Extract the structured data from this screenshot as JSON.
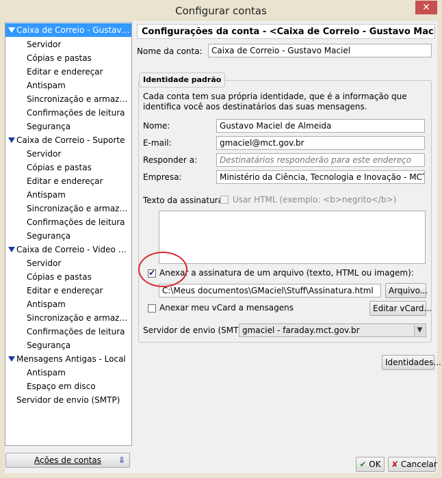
{
  "window": {
    "title": "Configurar contas",
    "close_glyph": "✕"
  },
  "tree": {
    "accounts": [
      {
        "label": "Caixa de Correio - Gustavo ...",
        "selected": true,
        "items": [
          "Servidor",
          "Cópias e pastas",
          "Editar e endereçar",
          "Antispam",
          "Sincronização e armazena...",
          "Confirmações de leitura",
          "Segurança"
        ]
      },
      {
        "label": "Caixa de Correio - Suporte",
        "selected": false,
        "items": [
          "Servidor",
          "Cópias e pastas",
          "Editar e endereçar",
          "Antispam",
          "Sincronização e armazena...",
          "Confirmações de leitura",
          "Segurança"
        ]
      },
      {
        "label": "Caixa de Correio - Video Conf...",
        "selected": false,
        "items": [
          "Servidor",
          "Cópias e pastas",
          "Editar e endereçar",
          "Antispam",
          "Sincronização e armazena...",
          "Confirmações de leitura",
          "Segurança"
        ]
      },
      {
        "label": "Mensagens Antigas - Local",
        "selected": false,
        "items": [
          "Antispam",
          "Espaço em disco"
        ]
      }
    ],
    "smtp_root": "Servidor de envio (SMTP)"
  },
  "account_actions": {
    "label": "Ações de contas",
    "arrow": "⇩"
  },
  "panel": {
    "title": "Configurações da conta - <Caixa de Correio - Gustavo Maciel>",
    "account_name_label": "Nome da conta:",
    "account_name_value": "Caixa de Correio - Gustavo Maciel",
    "identity": {
      "group_title": "Identidade padrão",
      "description": "Cada conta tem sua própria identidade, que é a informação que identifica você aos destinatários das suas mensagens.",
      "name_label": "Nome:",
      "name_value": "Gustavo Maciel de Almeida",
      "email_label": "E-mail:",
      "email_value": "gmaciel@mct.gov.br",
      "reply_label": "Responder a:",
      "reply_placeholder": "Destinatários responderão para este endereço",
      "org_label": "Empresa:",
      "org_value": "Ministério da Ciência, Tecnologia e Inovação - MCTI",
      "signature_label": "Texto da assinatura:",
      "use_html_label": "Usar HTML (exemplo: <b>negrito</b>)",
      "attach_sig_label": "Anexar a assinatura de um arquivo (texto, HTML ou imagem):",
      "attach_sig_checked": true,
      "sig_file_path": "C:\\Meus documentos\\GMaciel\\Stuff\\Assinatura.html",
      "browse_button": "Arquivo...",
      "vcard_label": "Anexar meu vCard a mensagens",
      "vcard_checked": false,
      "edit_vcard_button": "Editar vCard...",
      "smtp_label": "Servidor de envio (SMTP):",
      "smtp_value": "gmaciel - faraday.mct.gov.br"
    },
    "identities_button": "Identidades..."
  },
  "footer": {
    "ok": "OK",
    "cancel": "Cancelar",
    "ok_icon": "✔",
    "cancel_icon": "✘"
  },
  "colors": {
    "selection": "#3399ff",
    "annotation_circle": "#d8282c"
  }
}
